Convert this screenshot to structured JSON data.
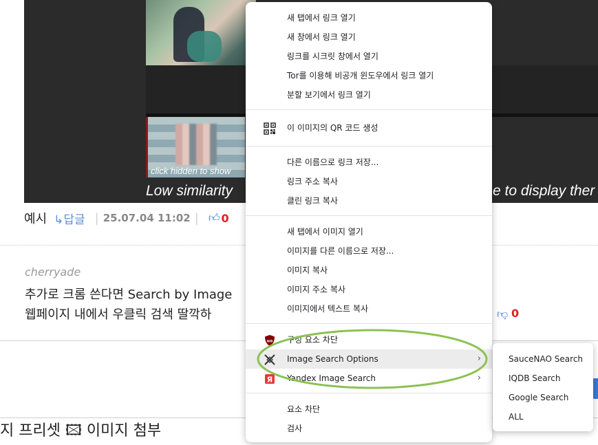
{
  "page": {
    "media": {
      "thumb_caption": "click hidden to show",
      "low_similarity_left": "Low similarity",
      "low_similarity_right": "e to display ther"
    },
    "comment1": {
      "author": "예시",
      "reply_label": "↳답글",
      "date": "25.07.04 11:02",
      "likes": "0"
    },
    "comment2": {
      "author": "cherryade",
      "line1": "추가로 크롬 쓴다면 Search by Image",
      "line2": "웹페이지 내에서 우클릭 검색 딸깍하",
      "dislikes": "0"
    },
    "bottom_text": "지 프리셋 🖾 이미지 첨부"
  },
  "context_menu": {
    "groups": [
      [
        "새 탭에서 링크 열기",
        "새 창에서 링크 열기",
        "링크를 시크릿 창에서 열기",
        "Tor를 이용해 비공개 윈도우에서 링크 열기",
        "분할 보기에서 링크 열기"
      ],
      [
        "이 이미지의 QR 코드 생성"
      ],
      [
        "다른 이름으로 링크 저장...",
        "링크 주소 복사",
        "클린 링크 복사"
      ],
      [
        "새 탭에서 이미지 열기",
        "이미지를 다른 이름으로 저장...",
        "이미지 복사",
        "이미지 주소 복사",
        "이미지에서 텍스트 복사"
      ],
      [
        "구성 요소 차단",
        "Image Search Options",
        "Yandex Image Search"
      ],
      [
        "요소 차단",
        "검사"
      ]
    ],
    "icons": {
      "qr": "qr-code-icon",
      "ublock": "ublock-origin-icon",
      "image_search": "image-search-options-icon",
      "yandex": "yandex-icon",
      "submenu_arrow": "chevron-right-icon"
    },
    "submenu": [
      "SauceNAO Search",
      "IQDB Search",
      "Google Search",
      "ALL"
    ]
  },
  "colors": {
    "annotation": "#8cc152",
    "menu_highlight": "#ececec",
    "like_blue": "#3b6fd6",
    "count_red": "#e02020"
  }
}
